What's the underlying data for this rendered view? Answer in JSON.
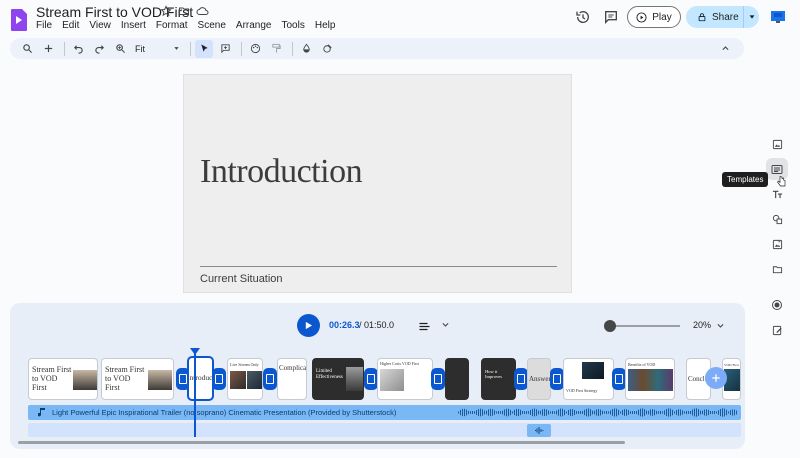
{
  "app": {
    "title": "Stream First to VOD First",
    "menu": [
      "File",
      "Edit",
      "View",
      "Insert",
      "Format",
      "Scene",
      "Arrange",
      "Tools",
      "Help"
    ],
    "play_label": "Play",
    "share_label": "Share",
    "accent": "#0b57d0",
    "icons": [
      "star-icon",
      "move-to-folder-icon",
      "cloud-status-icon",
      "version-history-icon",
      "comments-icon",
      "lock-icon",
      "account-avatar-icon"
    ]
  },
  "toolbar": {
    "zoom_value": "Fit",
    "icons": [
      "search-icon",
      "add-icon",
      "undo-icon",
      "redo-icon",
      "zoom-icon",
      "select-icon",
      "comment-icon",
      "paint-format-icon",
      "format-painter-icon",
      "fill-color-icon",
      "border-color-icon",
      "collapse-icon"
    ]
  },
  "slide": {
    "title": "Introduction",
    "subtitle": "Current Situation"
  },
  "rail": {
    "tooltip": "Templates",
    "icons": [
      "media-icon",
      "templates-icon",
      "text-icon",
      "shapes-icon",
      "image-icon",
      "folder-icon",
      "record-icon",
      "edit-icon"
    ]
  },
  "timeline": {
    "current_time": "00:26.3",
    "separator_total": "/ 01:50.0",
    "zoom_pct": "20%",
    "clips": [
      {
        "text": "Stream First to VOD First"
      },
      {
        "text": "Stream First to VOD First"
      },
      {
        "text": "Introduction"
      },
      {
        "text": "Live Stream Only"
      },
      {
        "text": "Complicated"
      },
      {
        "text": "Limited Effectiveness"
      },
      {
        "text": "Higher Costs  VOD First"
      },
      {
        "text": ""
      },
      {
        "text": "How it Improves"
      },
      {
        "text": "Answer"
      },
      {
        "text": "VOD First Strategy"
      },
      {
        "text": "Benefits of VOD"
      },
      {
        "text": "Conclusion"
      },
      {
        "text": "VOD First"
      }
    ],
    "audio_label": "Light Powerful Epic Inspirational Trailer (no soprano) Cinematic Presentation (Provided by Shutterstock)"
  }
}
